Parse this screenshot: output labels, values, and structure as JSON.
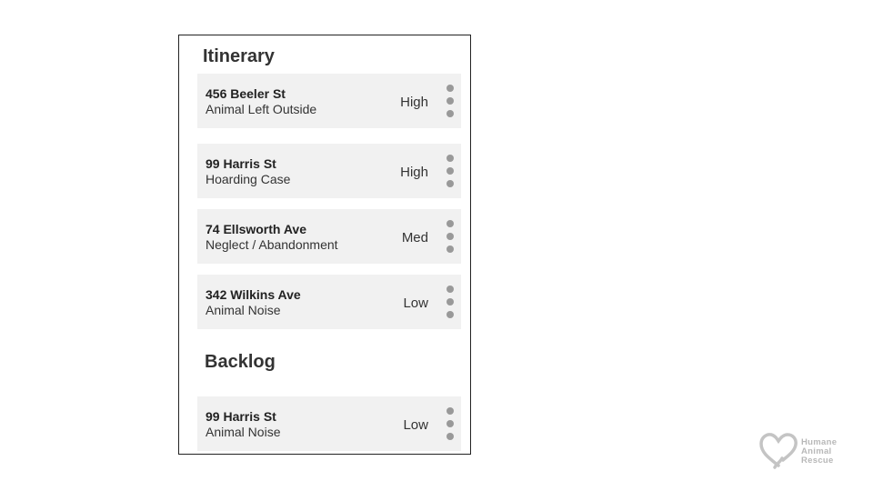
{
  "itinerary": {
    "title": "Itinerary",
    "cases": [
      {
        "address": "456 Beeler St",
        "case_type": "Animal Left Outside",
        "priority": "High"
      },
      {
        "address": "99 Harris St",
        "case_type": "Hoarding Case",
        "priority": "High"
      },
      {
        "address": "74 Ellsworth Ave",
        "case_type": "Neglect / Abandonment",
        "priority": "Med"
      },
      {
        "address": "342 Wilkins Ave",
        "case_type": "Animal Noise",
        "priority": "Low"
      }
    ]
  },
  "backlog": {
    "title": "Backlog",
    "cases": [
      {
        "address": "99 Harris St",
        "case_type": "Animal Noise",
        "priority": "Low"
      }
    ]
  },
  "logo": {
    "line1": "Humane",
    "line2": "Animal",
    "line3": "Rescue",
    "icon": "heart-outline-icon",
    "color": "#b8b8b8"
  },
  "colors": {
    "card_background": "#f1f1f1",
    "menu_dot": "#999999",
    "panel_border": "#222222"
  }
}
